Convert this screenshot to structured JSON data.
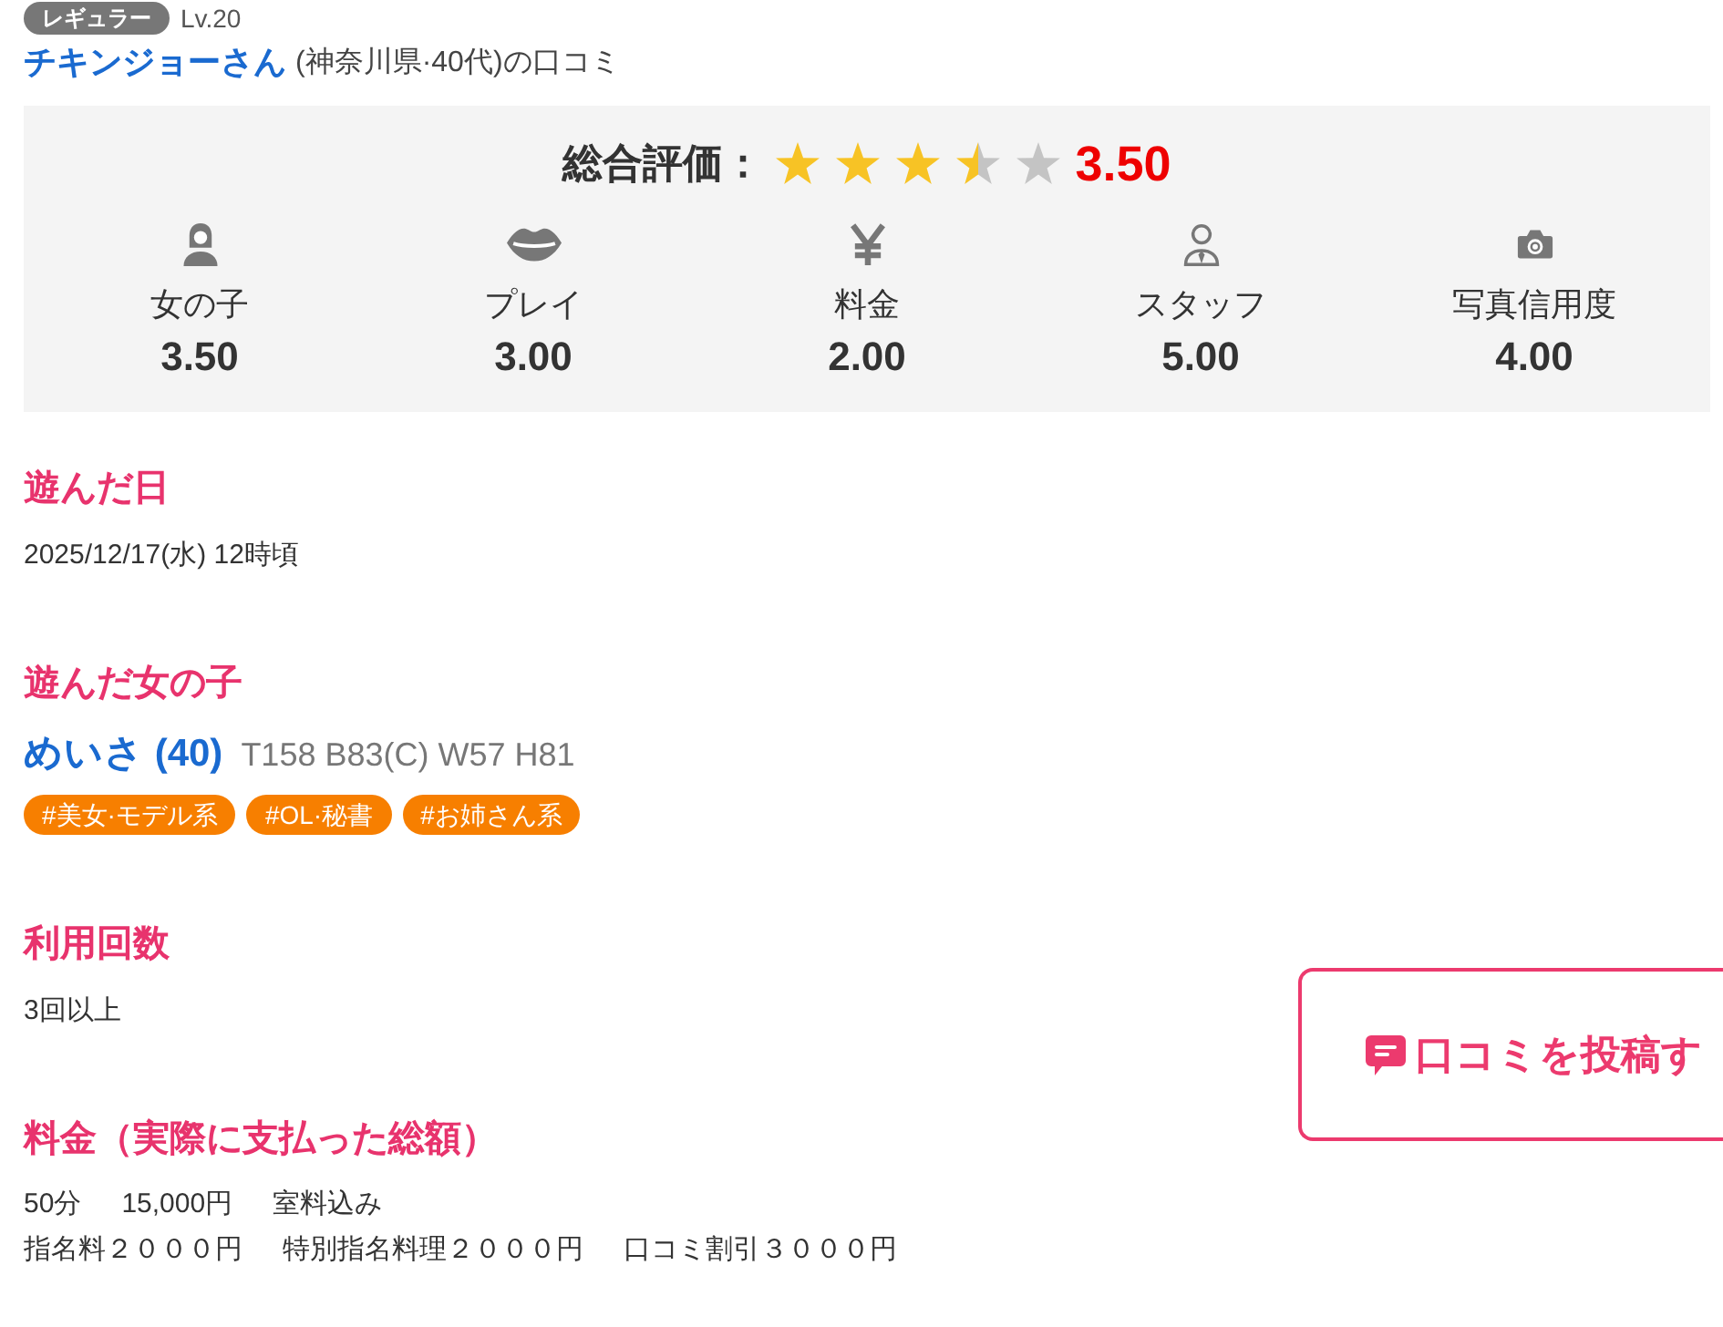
{
  "reviewer": {
    "rank": "レギュラー",
    "level": "Lv.20",
    "name": "チキンジョーさん",
    "info": "(神奈川県·40代)の口コミ"
  },
  "rating": {
    "label": "総合評価：",
    "stars": 3.5,
    "score": "3.50",
    "categories": [
      {
        "label": "女の子",
        "score": "3.50"
      },
      {
        "label": "プレイ",
        "score": "3.00"
      },
      {
        "label": "料金",
        "score": "2.00"
      },
      {
        "label": "スタッフ",
        "score": "5.00"
      },
      {
        "label": "写真信用度",
        "score": "4.00"
      }
    ]
  },
  "sections": [
    {
      "kind": "text",
      "heading": "遊んだ日",
      "text": "2025/12/17(水) 12時頃"
    },
    {
      "kind": "girl",
      "heading": "遊んだ女の子",
      "name": "めいさ (40)",
      "size": "T158 B83(C) W57 H81",
      "tags": [
        "#美女·モデル系",
        "#OL·秘書",
        "#お姉さん系"
      ]
    },
    {
      "kind": "text",
      "heading": "利用回数",
      "text": "3回以上"
    },
    {
      "kind": "lines",
      "heading": "料金（実際に支払った総額）",
      "lines": [
        [
          "50分",
          "15,000円",
          "室料込み"
        ],
        [
          "指名料２０００円",
          "特別指名料理２０００円",
          "口コミ割引３０００円"
        ]
      ]
    }
  ],
  "post_button": {
    "label": "口コミを投稿す"
  }
}
